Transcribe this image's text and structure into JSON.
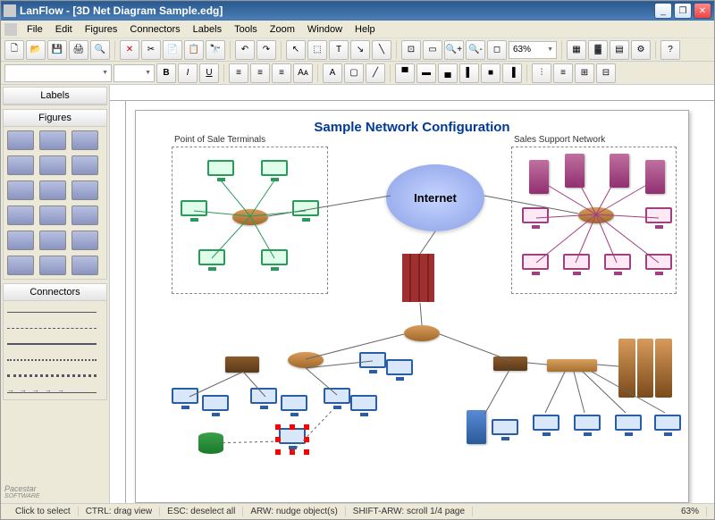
{
  "window": {
    "app": "LanFlow",
    "doc": "[3D Net Diagram Sample.edg]",
    "brand": "Pacestar",
    "brand2": "SOFTWARE"
  },
  "menu": [
    "File",
    "Edit",
    "Figures",
    "Connectors",
    "Labels",
    "Tools",
    "Zoom",
    "Window",
    "Help"
  ],
  "toolbar2": {
    "zoom": "63%"
  },
  "sidebar": {
    "labels": "Labels",
    "figures": "Figures",
    "connectors": "Connectors"
  },
  "diagram": {
    "title": "Sample Network Configuration",
    "group_pos": "Point of Sale Terminals",
    "group_sales": "Sales Support Network",
    "cloud": "Internet"
  },
  "status": {
    "s1": "Click to select",
    "s2": "CTRL: drag view",
    "s3": "ESC: deselect all",
    "s4": "ARW: nudge object(s)",
    "s5": "SHIFT-ARW: scroll 1/4 page",
    "zoom": "63%"
  }
}
